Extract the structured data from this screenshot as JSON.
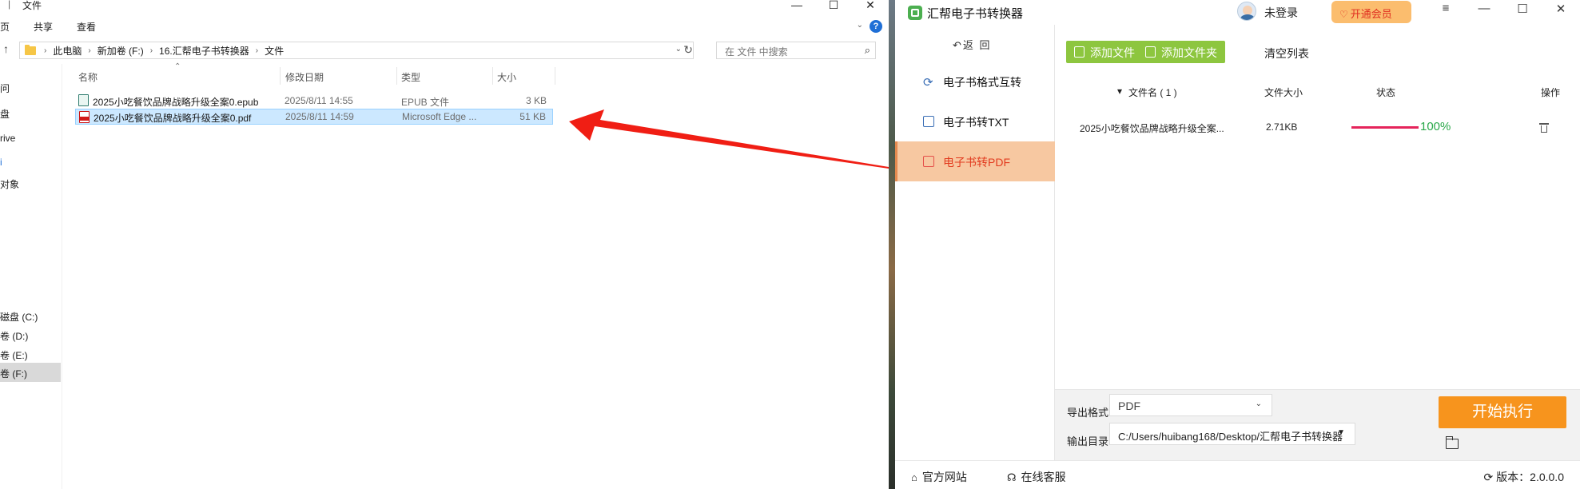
{
  "explorer": {
    "title": "文件",
    "win_buttons": [
      "—",
      "☐",
      "✕"
    ],
    "ribbon": [
      "页",
      "共享",
      "查看"
    ],
    "help": "?",
    "breadcrumb": [
      "此电脑",
      "新加卷 (F:)",
      "16.汇帮电子书转换器",
      "文件"
    ],
    "search_placeholder": "在 文件 中搜索",
    "nav_items": [
      "问",
      "盘",
      "rive",
      "i",
      "对象",
      "磁盘 (C:)",
      "卷 (D:)",
      "卷 (E:)",
      "卷 (F:)"
    ],
    "columns": [
      "名称",
      "修改日期",
      "类型",
      "大小"
    ],
    "files": [
      {
        "name": "2025小吃餐饮品牌战略升级全案0.epub",
        "date": "2025/8/11 14:55",
        "type": "EPUB 文件",
        "size": "3 KB",
        "icon": "epub-file-icon"
      },
      {
        "name": "2025小吃餐饮品牌战略升级全案0.pdf",
        "date": "2025/8/11 14:59",
        "type": "Microsoft Edge ...",
        "size": "51 KB",
        "icon": "pdf-file-icon"
      }
    ]
  },
  "app": {
    "title": "汇帮电子书转换器",
    "login": "未登录",
    "vip": "开通会员",
    "win_buttons": [
      "≡",
      "—",
      "☐",
      "✕"
    ],
    "back": "返 回",
    "sidebar": [
      {
        "label": "电子书格式互转",
        "icon": "refresh-icon"
      },
      {
        "label": "电子书转TXT",
        "icon": "txt-doc-icon"
      },
      {
        "label": "电子书转PDF",
        "icon": "pdf-doc-icon"
      }
    ],
    "toolbar": {
      "add_file": "添加文件",
      "add_folder": "添加文件夹",
      "clear": "清空列表"
    },
    "table": {
      "headers": [
        "文件名 ( 1 )",
        "文件大小",
        "状态",
        "操作"
      ],
      "rows": [
        {
          "name": "2025小吃餐饮品牌战略升级全案...",
          "size": "2.71KB",
          "progress": 1.0,
          "progress_text": "100%"
        }
      ]
    },
    "export": {
      "format_label": "导出格式:",
      "format_value": "PDF",
      "dir_label": "输出目录:",
      "dir_value": "C:/Users/huibang168/Desktop/汇帮电子书转换器",
      "start": "开始执行"
    },
    "status": {
      "website": "官方网站",
      "service": "在线客服",
      "version": "版本：2.0.0.0"
    },
    "colors": {
      "accent_green": "#8dc63f",
      "accent_orange": "#f7941d",
      "active_bg": "#f7c8a1",
      "active_text": "#e23b1f",
      "progress": "#e5245b",
      "arrow": "#f01e14"
    }
  }
}
